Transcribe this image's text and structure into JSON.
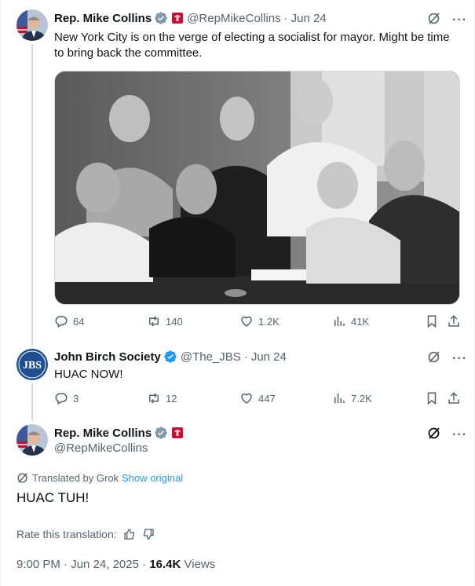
{
  "tweet1": {
    "name": "Rep. Mike Collins",
    "handle": "@RepMikeCollins",
    "date": "Jun 24",
    "text": "New York City is on the verge of electing a socialist for mayor. Might be time to bring back the committee.",
    "stats": {
      "replies": "64",
      "reposts": "140",
      "likes": "1.2K",
      "views": "41K"
    }
  },
  "tweet2": {
    "name": "John Birch Society",
    "handle": "@The_JBS",
    "date": "Jun 24",
    "avatar_text": "JBS",
    "text": "HUAC NOW!",
    "stats": {
      "replies": "3",
      "reposts": "12",
      "likes": "447",
      "views": "7.2K"
    }
  },
  "tweet3": {
    "name": "Rep. Mike Collins",
    "handle": "@RepMikeCollins",
    "translated_label": "Translated by Grok",
    "show_original": "Show original",
    "text": "HUAC TUH!",
    "rate_label": "Rate this translation:",
    "time": "9:00 PM",
    "date": "Jun 24, 2025",
    "views_count": "16.4K",
    "views_label": "Views"
  },
  "icons": {
    "verified": "verified-badge-icon",
    "flag": "government-flag-icon",
    "grok": "grok-icon",
    "more": "more-dots-icon",
    "reply": "reply-icon",
    "repost": "repost-icon",
    "like": "heart-icon",
    "views": "views-chart-icon",
    "bookmark": "bookmark-icon",
    "share": "share-icon"
  },
  "colors": {
    "accent": "#1d9bf0",
    "muted": "#536471",
    "text": "#0f1419",
    "flag": "#c8102e"
  }
}
